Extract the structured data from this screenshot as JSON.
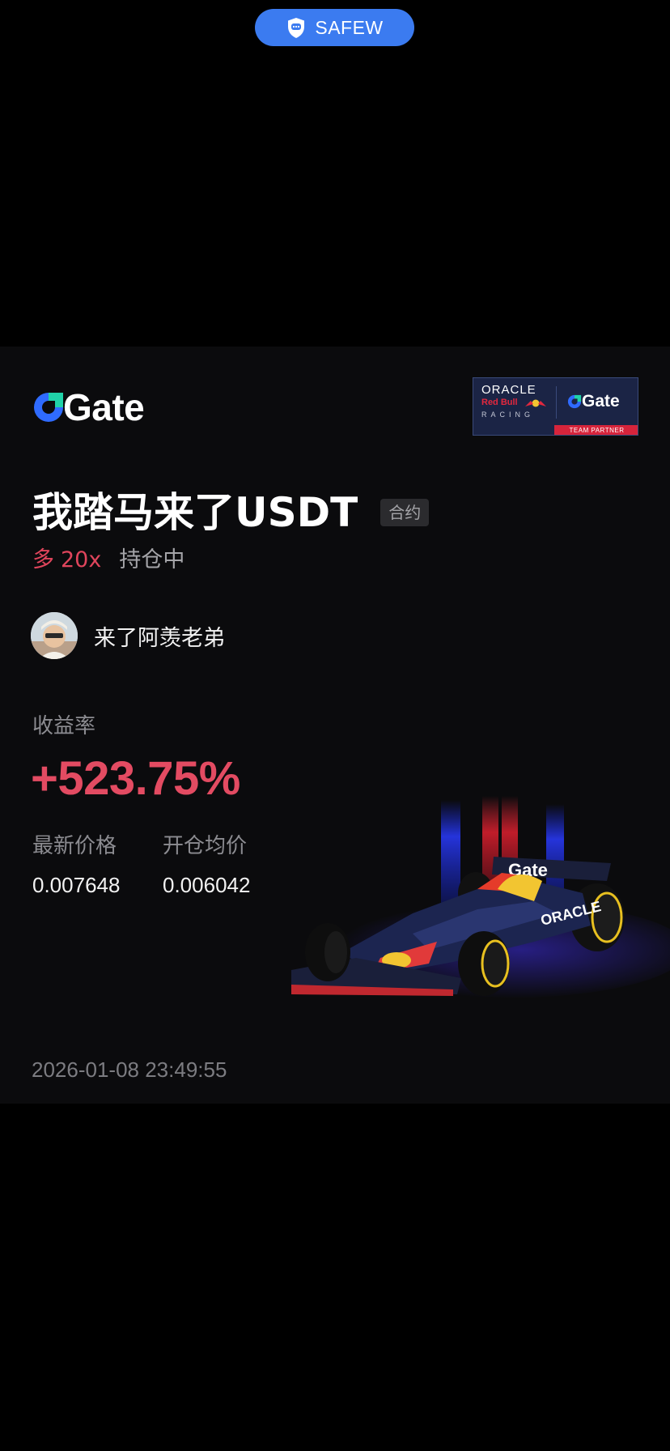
{
  "topbar": {
    "label": "SAFEW",
    "accent": "#3b7bf0"
  },
  "card": {
    "brand": "Gate",
    "partner": {
      "oracle": "ORACLE",
      "redbull": "Red Bull",
      "racing": "RACING",
      "gate": "Gate",
      "team_partner": "TEAM PARTNER"
    },
    "title": "我踏马来了USDT",
    "tag": "合约",
    "position": {
      "direction": "多",
      "leverage": "20x",
      "status": "持仓中"
    },
    "user": {
      "name": "来了阿羡老弟"
    },
    "profit": {
      "label": "收益率",
      "value": "+523.75%",
      "color": "#e34b62"
    },
    "prices": {
      "latest_label": "最新价格",
      "latest_value": "0.007648",
      "open_label": "开仓均价",
      "open_value": "0.006042"
    },
    "timestamp": "2026-01-08 23:49:55",
    "car_livery_text": "Gate"
  }
}
